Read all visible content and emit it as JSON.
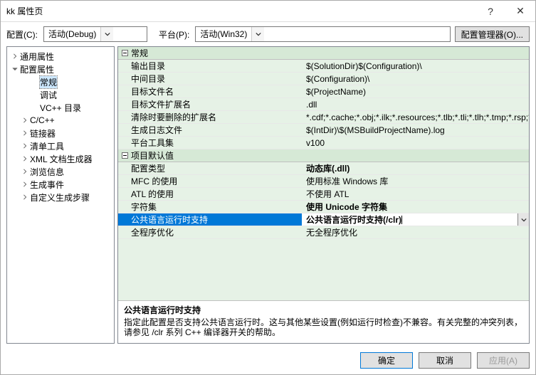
{
  "window": {
    "title": "kk 属性页"
  },
  "topbar": {
    "config_label": "配置(C):",
    "config_value": "活动(Debug)",
    "platform_label": "平台(P):",
    "platform_value": "活动(Win32)",
    "config_manager": "配置管理器(O)..."
  },
  "tree": {
    "items": [
      {
        "label": "通用属性",
        "indent": 0,
        "toggle": "right"
      },
      {
        "label": "配置属性",
        "indent": 0,
        "toggle": "down"
      },
      {
        "label": "常规",
        "indent": 2,
        "selected": true
      },
      {
        "label": "调试",
        "indent": 2
      },
      {
        "label": "VC++ 目录",
        "indent": 2
      },
      {
        "label": "C/C++",
        "indent": 1,
        "toggle": "right"
      },
      {
        "label": "链接器",
        "indent": 1,
        "toggle": "right"
      },
      {
        "label": "清单工具",
        "indent": 1,
        "toggle": "right"
      },
      {
        "label": "XML 文档生成器",
        "indent": 1,
        "toggle": "right"
      },
      {
        "label": "浏览信息",
        "indent": 1,
        "toggle": "right"
      },
      {
        "label": "生成事件",
        "indent": 1,
        "toggle": "right"
      },
      {
        "label": "自定义生成步骤",
        "indent": 1,
        "toggle": "right"
      }
    ]
  },
  "grid": {
    "cats": [
      {
        "name": "常规",
        "rows": [
          {
            "k": "输出目录",
            "v": "$(SolutionDir)$(Configuration)\\"
          },
          {
            "k": "中间目录",
            "v": "$(Configuration)\\"
          },
          {
            "k": "目标文件名",
            "v": "$(ProjectName)"
          },
          {
            "k": "目标文件扩展名",
            "v": ".dll"
          },
          {
            "k": "清除时要删除的扩展名",
            "v": "*.cdf;*.cache;*.obj;*.ilk;*.resources;*.tlb;*.tli;*.tlh;*.tmp;*.rsp;*.pgc"
          },
          {
            "k": "生成日志文件",
            "v": "$(IntDir)\\$(MSBuildProjectName).log"
          },
          {
            "k": "平台工具集",
            "v": "v100"
          }
        ]
      },
      {
        "name": "项目默认值",
        "rows": [
          {
            "k": "配置类型",
            "v": "动态库(.dll)",
            "bold": true
          },
          {
            "k": "MFC 的使用",
            "v": "使用标准 Windows 库"
          },
          {
            "k": "ATL 的使用",
            "v": "不使用 ATL"
          },
          {
            "k": "字符集",
            "v": "使用 Unicode 字符集",
            "bold": true
          },
          {
            "k": "公共语言运行时支持",
            "v": "公共语言运行时支持(/clr)",
            "bold": true,
            "selected": true,
            "dropdown": true
          },
          {
            "k": "全程序优化",
            "v": "无全程序优化"
          }
        ]
      }
    ]
  },
  "desc": {
    "title": "公共语言运行时支持",
    "body": "指定此配置是否支持公共语言运行时。这与其他某些设置(例如运行时检查)不兼容。有关完整的冲突列表，请参见 /clr 系列 C++ 编译器开关的帮助。"
  },
  "footer": {
    "ok": "确定",
    "cancel": "取消",
    "apply": "应用(A)"
  }
}
